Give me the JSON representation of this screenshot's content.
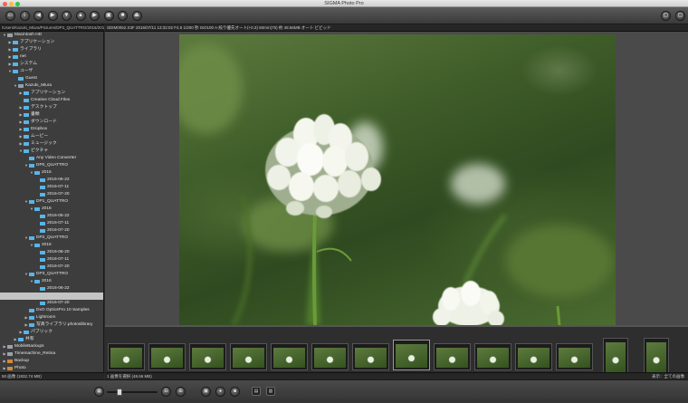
{
  "window": {
    "title": "SIGMA Photo Pro"
  },
  "toolbar": {
    "left_icons": [
      {
        "name": "open-folder-icon",
        "glyph": "▭"
      },
      {
        "name": "info-icon",
        "glyph": "i"
      },
      {
        "name": "back-icon",
        "glyph": "◀"
      },
      {
        "name": "forward-icon",
        "glyph": "▶"
      },
      {
        "name": "save-icon",
        "glyph": "▼"
      },
      {
        "name": "print-icon",
        "glyph": "▲"
      },
      {
        "name": "play-icon",
        "glyph": "▶"
      },
      {
        "name": "slideshow-icon",
        "glyph": "▣"
      },
      {
        "name": "stop-icon",
        "glyph": "■"
      },
      {
        "name": "eject-icon",
        "glyph": "⏏"
      }
    ],
    "right_icons": [
      {
        "name": "rotate-left-icon",
        "glyph": "▢"
      },
      {
        "name": "rotate-right-icon",
        "glyph": "▢"
      }
    ]
  },
  "path_bar": "/Users/Kazuki_Miura/Pictures/DP3_QUATTRO/2016/2016",
  "info_bar": "SDIM0052.X3F 2016/07/11 13:32:02 F4.5 1/200 秒 ISO100 A-絞り優先オート(+0.3) 50mm(75) 約 48.66MB オート ビビッド",
  "tree": [
    {
      "label": "Macintosh HD",
      "indent": 0,
      "arrow": "▼",
      "icon": "drive"
    },
    {
      "label": "アプリケーション",
      "indent": 1,
      "arrow": "▶",
      "icon": "folder"
    },
    {
      "label": "ライブラリ",
      "indent": 1,
      "arrow": "▶",
      "icon": "folder"
    },
    {
      "label": "net",
      "indent": 1,
      "arrow": "▶",
      "icon": "folder"
    },
    {
      "label": "システム",
      "indent": 1,
      "arrow": "▶",
      "icon": "folder"
    },
    {
      "label": "ユーザ",
      "indent": 1,
      "arrow": "▼",
      "icon": "folder"
    },
    {
      "label": "Guest",
      "indent": 2,
      "arrow": "",
      "icon": "folder"
    },
    {
      "label": "Kazuki_Miura",
      "indent": 2,
      "arrow": "▼",
      "icon": "home"
    },
    {
      "label": "アプリケーション",
      "indent": 3,
      "arrow": "▶",
      "icon": "folder"
    },
    {
      "label": "Creative Cloud Files",
      "indent": 3,
      "arrow": "",
      "icon": "folder"
    },
    {
      "label": "デスクトップ",
      "indent": 3,
      "arrow": "▶",
      "icon": "folder"
    },
    {
      "label": "書類",
      "indent": 3,
      "arrow": "▶",
      "icon": "folder"
    },
    {
      "label": "ダウンロード",
      "indent": 3,
      "arrow": "▶",
      "icon": "folder"
    },
    {
      "label": "Dropbox",
      "indent": 3,
      "arrow": "▶",
      "icon": "folder"
    },
    {
      "label": "ムービー",
      "indent": 3,
      "arrow": "▶",
      "icon": "folder"
    },
    {
      "label": "ミュージック",
      "indent": 3,
      "arrow": "▶",
      "icon": "folder"
    },
    {
      "label": "ピクチャ",
      "indent": 3,
      "arrow": "▼",
      "icon": "folder"
    },
    {
      "label": "Any Video Converter",
      "indent": 4,
      "arrow": "",
      "icon": "folder"
    },
    {
      "label": "DP0_QUATTRO",
      "indent": 4,
      "arrow": "▼",
      "icon": "folder"
    },
    {
      "label": "2016",
      "indent": 5,
      "arrow": "▼",
      "icon": "folder"
    },
    {
      "label": "2016-06-22",
      "indent": 6,
      "arrow": "",
      "icon": "folder"
    },
    {
      "label": "2016-07-11",
      "indent": 6,
      "arrow": "",
      "icon": "folder"
    },
    {
      "label": "2016-07-20",
      "indent": 6,
      "arrow": "",
      "icon": "folder"
    },
    {
      "label": "DP1_QUATTRO",
      "indent": 4,
      "arrow": "▼",
      "icon": "folder"
    },
    {
      "label": "2016",
      "indent": 5,
      "arrow": "▼",
      "icon": "folder"
    },
    {
      "label": "2016-06-22",
      "indent": 6,
      "arrow": "",
      "icon": "folder"
    },
    {
      "label": "2016-07-11",
      "indent": 6,
      "arrow": "",
      "icon": "folder"
    },
    {
      "label": "2016-07-20",
      "indent": 6,
      "arrow": "",
      "icon": "folder"
    },
    {
      "label": "DP2_QUATTRO",
      "indent": 4,
      "arrow": "▼",
      "icon": "folder"
    },
    {
      "label": "2016",
      "indent": 5,
      "arrow": "▼",
      "icon": "folder"
    },
    {
      "label": "2016-06-20",
      "indent": 6,
      "arrow": "",
      "icon": "folder"
    },
    {
      "label": "2016-07-11",
      "indent": 6,
      "arrow": "",
      "icon": "folder"
    },
    {
      "label": "2016-07-20",
      "indent": 6,
      "arrow": "",
      "icon": "folder"
    },
    {
      "label": "DP3_QUATTRO",
      "indent": 4,
      "arrow": "▼",
      "icon": "folder"
    },
    {
      "label": "2016",
      "indent": 5,
      "arrow": "▼",
      "icon": "folder"
    },
    {
      "label": "2016-06-22",
      "indent": 6,
      "arrow": "",
      "icon": "folder"
    },
    {
      "label": "",
      "indent": 6,
      "arrow": "",
      "icon": "none",
      "selected": true
    },
    {
      "label": "2016-07-20",
      "indent": 6,
      "arrow": "",
      "icon": "folder"
    },
    {
      "label": "DxO OpticsPro 10 Samples",
      "indent": 4,
      "arrow": "",
      "icon": "folder"
    },
    {
      "label": "Lightroom",
      "indent": 4,
      "arrow": "▶",
      "icon": "folder"
    },
    {
      "label": "写真ライブラリ.photoslibrary",
      "indent": 4,
      "arrow": "▶",
      "icon": "folder"
    },
    {
      "label": "パブリック",
      "indent": 3,
      "arrow": "▶",
      "icon": "folder"
    },
    {
      "label": "共有",
      "indent": 2,
      "arrow": "▶",
      "icon": "folder"
    },
    {
      "label": "MobileBackups",
      "indent": 0,
      "arrow": "▶",
      "icon": "drive"
    },
    {
      "label": "Timemachine_Retina",
      "indent": 0,
      "arrow": "▶",
      "icon": "drive"
    },
    {
      "label": "Backup",
      "indent": 0,
      "arrow": "▶",
      "icon": "ext"
    },
    {
      "label": "Photo",
      "indent": 0,
      "arrow": "▶",
      "icon": "ext"
    }
  ],
  "status": {
    "tree": "50 画像 (1832.74 MB)",
    "view": "1 画像を選択 (48.66 MB)",
    "view_right": "表示：全ての画像"
  },
  "filmstrip": {
    "count": 14,
    "active_index": 7,
    "portrait_indices": [
      12,
      13
    ]
  },
  "bottombar": {
    "left_icon": "grid-view-icon",
    "slider_level": 0.25,
    "buttons": [
      {
        "name": "fit-view-icon",
        "glyph": "⊟"
      },
      {
        "name": "zoom-view-icon",
        "glyph": "⊞"
      },
      {
        "name": "single-view-icon",
        "glyph": "▣"
      },
      {
        "name": "record-icon",
        "glyph": "●"
      },
      {
        "name": "stop-icon",
        "glyph": "■"
      },
      {
        "name": "print-icon",
        "glyph": "▤"
      },
      {
        "name": "trash-icon",
        "glyph": "▥"
      }
    ]
  },
  "colors": {
    "folder": "#59b5e8",
    "selection": "#c4c4c4",
    "panel": "#3d3d3d"
  }
}
